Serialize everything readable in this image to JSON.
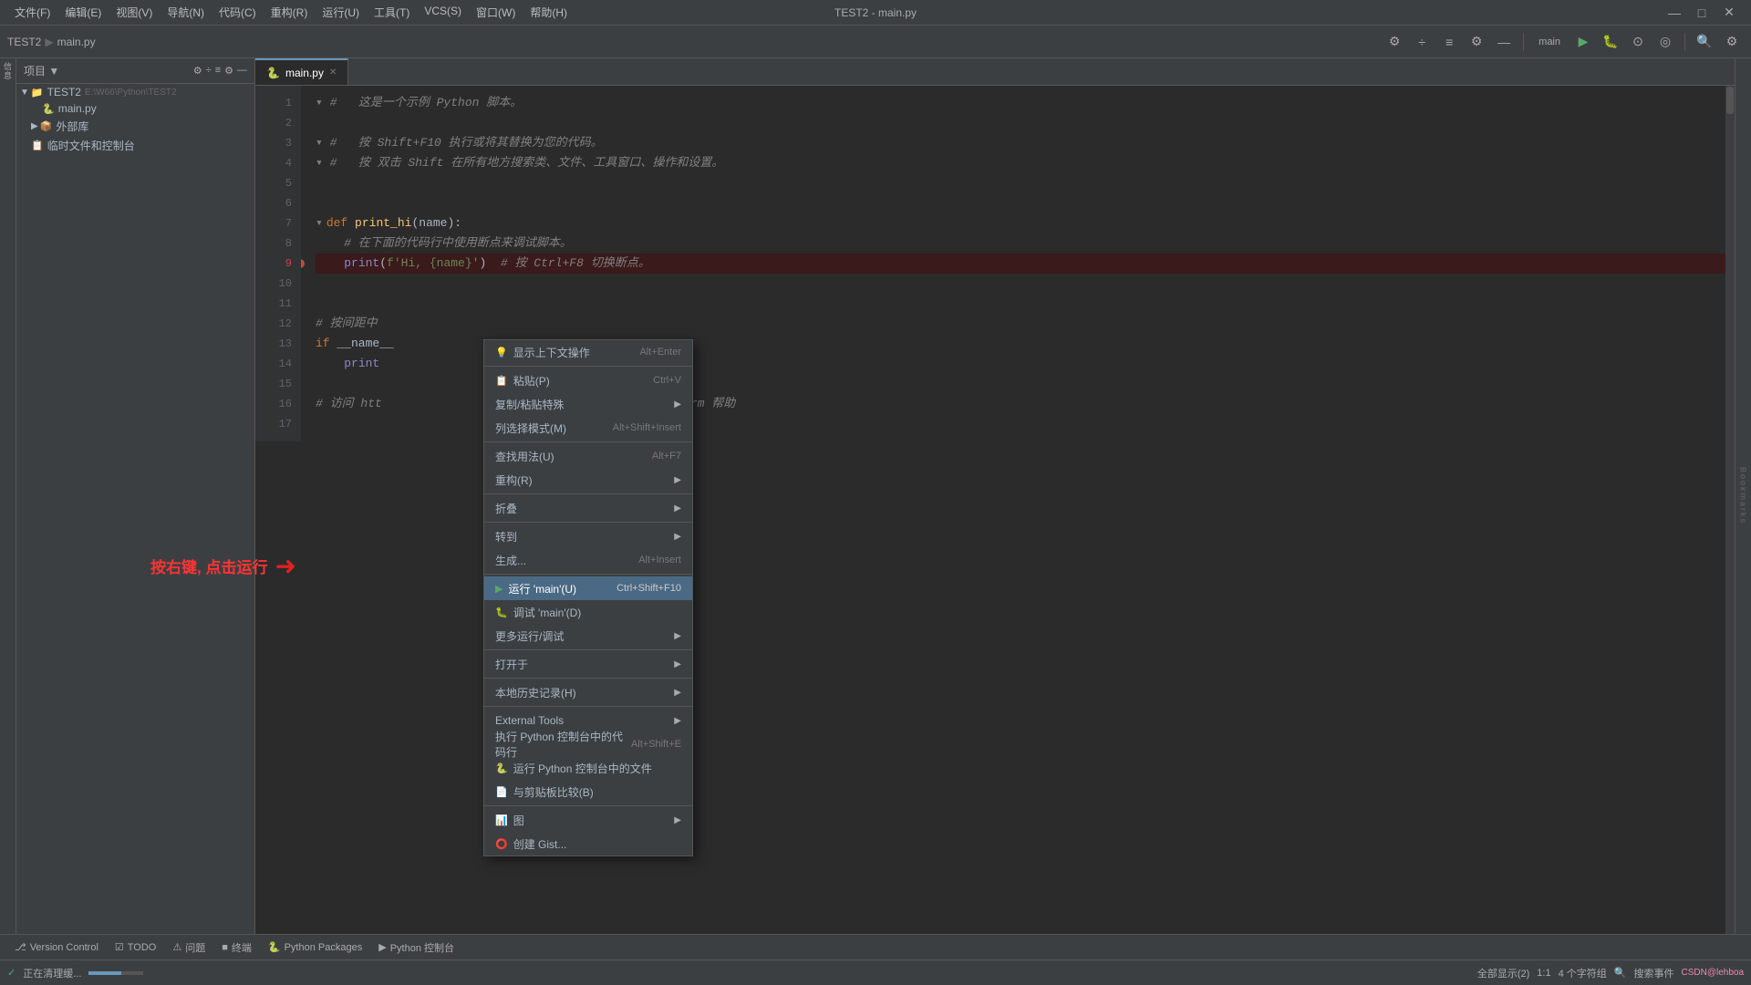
{
  "titleBar": {
    "menus": [
      "文件(F)",
      "编辑(E)",
      "视图(V)",
      "导航(N)",
      "代码(C)",
      "重构(R)",
      "运行(U)",
      "工具(T)",
      "VCS(S)",
      "窗口(W)",
      "帮助(H)"
    ],
    "title": "TEST2 - main.py",
    "windowControls": [
      "—",
      "□",
      "×"
    ]
  },
  "toolbar": {
    "projectLabel": "▼ 项目 ▼",
    "icons": [
      "⚙",
      "÷",
      "≡",
      "⚙",
      "—"
    ]
  },
  "projectPanel": {
    "title": "项目",
    "root": {
      "label": "TEST2",
      "path": "E:\\W66\\Python\\TEST2"
    },
    "items": [
      {
        "label": "main.py",
        "indent": 24,
        "icon": "🐍"
      },
      {
        "label": "外部库",
        "indent": 16,
        "icon": "📁"
      },
      {
        "label": "临时文件和控制台",
        "indent": 16,
        "icon": "📋"
      }
    ]
  },
  "tabs": [
    {
      "label": "main.py",
      "active": true,
      "icon": "🐍"
    }
  ],
  "codeLines": [
    {
      "num": 1,
      "content": "#   这是一个示例 Python 脚本。",
      "type": "comment"
    },
    {
      "num": 2,
      "content": "",
      "type": "empty"
    },
    {
      "num": 3,
      "content": "#   按 Shift+F10 执行或将其替换为您的代码。",
      "type": "comment"
    },
    {
      "num": 4,
      "content": "#   按 双击 Shift 在所有地方搜索类、文件、工具窗口、操作和设置。",
      "type": "comment"
    },
    {
      "num": 5,
      "content": "",
      "type": "empty"
    },
    {
      "num": 6,
      "content": "",
      "type": "empty"
    },
    {
      "num": 7,
      "content": "def print_hi(name):",
      "type": "def"
    },
    {
      "num": 8,
      "content": "    # 在下面的代码行中使用断点来调试脚本。",
      "type": "comment"
    },
    {
      "num": 9,
      "content": "    print(f'Hi, {name}')  # 按 Ctrl+F8 切换断点。",
      "type": "breakpoint"
    },
    {
      "num": 10,
      "content": "",
      "type": "empty"
    },
    {
      "num": 11,
      "content": "",
      "type": "empty"
    },
    {
      "num": 12,
      "content": "# 按间距中",
      "type": "comment"
    },
    {
      "num": 13,
      "content": "if __name__",
      "type": "code"
    },
    {
      "num": 14,
      "content": "    print",
      "type": "code"
    },
    {
      "num": 15,
      "content": "",
      "type": "empty"
    },
    {
      "num": 16,
      "content": "# 访问 htt                        /pycharm/ 获取 PyCharm 帮助",
      "type": "comment"
    },
    {
      "num": 17,
      "content": "",
      "type": "empty"
    }
  ],
  "contextMenu": {
    "items": [
      {
        "label": "显示上下文操作",
        "shortcut": "Alt+Enter",
        "icon": "💡",
        "hasSub": false,
        "active": false
      },
      {
        "separator": false
      },
      {
        "label": "粘贴(P)",
        "shortcut": "Ctrl+V",
        "icon": "📋",
        "hasSub": false,
        "active": false
      },
      {
        "label": "复制/粘贴特殊",
        "shortcut": "",
        "icon": "",
        "hasSub": true,
        "active": false
      },
      {
        "label": "列选择模式(M)",
        "shortcut": "Alt+Shift+Insert",
        "icon": "",
        "hasSub": false,
        "active": false
      },
      {
        "separator_1": false
      },
      {
        "label": "查找用法(U)",
        "shortcut": "Alt+F7",
        "icon": "",
        "hasSub": false,
        "active": false
      },
      {
        "label": "重构(R)",
        "shortcut": "",
        "icon": "",
        "hasSub": true,
        "active": false
      },
      {
        "separator_2": false
      },
      {
        "label": "折叠",
        "shortcut": "",
        "icon": "",
        "hasSub": true,
        "active": false
      },
      {
        "separator_3": false
      },
      {
        "label": "转到",
        "shortcut": "",
        "icon": "",
        "hasSub": true,
        "active": false
      },
      {
        "label": "生成...",
        "shortcut": "Alt+Insert",
        "icon": "",
        "hasSub": false,
        "active": false
      },
      {
        "separator_4": false
      },
      {
        "label": "运行 'main'(U)",
        "shortcut": "Ctrl+Shift+F10",
        "icon": "▶",
        "hasSub": false,
        "active": true
      },
      {
        "label": "调试 'main'(D)",
        "shortcut": "",
        "icon": "🐛",
        "hasSub": false,
        "active": false
      },
      {
        "label": "更多运行/调试",
        "shortcut": "",
        "icon": "",
        "hasSub": true,
        "active": false
      },
      {
        "separator_5": false
      },
      {
        "label": "打开于",
        "shortcut": "",
        "icon": "",
        "hasSub": true,
        "active": false
      },
      {
        "separator_6": false
      },
      {
        "label": "本地历史记录(H)",
        "shortcut": "",
        "icon": "",
        "hasSub": true,
        "active": false
      },
      {
        "separator_7": false
      },
      {
        "label": "External Tools",
        "shortcut": "",
        "icon": "",
        "hasSub": true,
        "active": false
      },
      {
        "label": "执行 Python 控制台中的代码行",
        "shortcut": "Alt+Shift+E",
        "icon": "",
        "hasSub": false,
        "active": false
      },
      {
        "label": "运行 Python 控制台中的文件",
        "shortcut": "",
        "icon": "🐍",
        "hasSub": false,
        "active": false
      },
      {
        "label": "与剪贴板比较(B)",
        "shortcut": "",
        "icon": "📄",
        "hasSub": false,
        "active": false
      },
      {
        "separator_8": false
      },
      {
        "label": "图",
        "shortcut": "",
        "icon": "📊",
        "hasSub": true,
        "active": false
      },
      {
        "label": "创建 Gist...",
        "shortcut": "",
        "icon": "⭕",
        "hasSub": false,
        "active": false
      }
    ]
  },
  "annotation": {
    "text": "按右键, 点击运行"
  },
  "bottomTabs": [
    {
      "label": "Version Control",
      "icon": ""
    },
    {
      "label": "TODO",
      "icon": ""
    },
    {
      "label": "⚠ 问题",
      "icon": "warn"
    },
    {
      "label": "■ 终端",
      "icon": ""
    },
    {
      "label": "Python Packages",
      "icon": ""
    },
    {
      "label": "▶ Python 控制台",
      "icon": ""
    }
  ],
  "statusBar": {
    "progressText": "正在清理缓...",
    "linesText": "全部显示(2)",
    "positionText": "1:1",
    "encodingText": "4 个字符组",
    "searchIcon": "🔍",
    "searchText": "搜索事件",
    "warningText": "⚠",
    "csdn": "CSDN@lehboa"
  }
}
